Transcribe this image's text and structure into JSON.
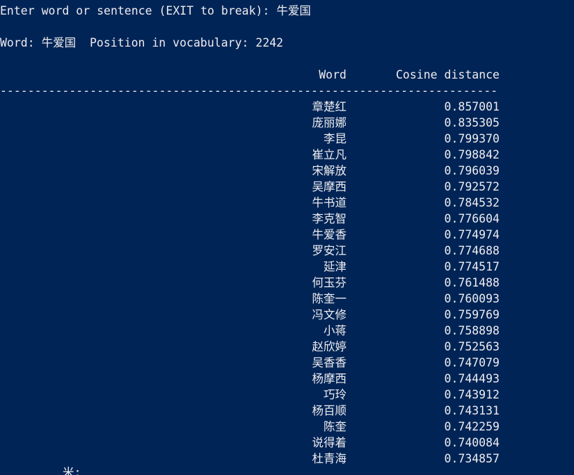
{
  "console": {
    "prompt_line": "Enter word or sentence (EXIT to break): 牛爱国",
    "word_line": "Word: 牛爱国  Position in vocabulary: 2242",
    "header": {
      "word": "Word",
      "distance": "Cosine distance"
    },
    "rule": "------------------------------------------------------------------------",
    "results": [
      {
        "word": "章楚红",
        "distance": "0.857001"
      },
      {
        "word": "庞丽娜",
        "distance": "0.835305"
      },
      {
        "word": "李昆",
        "distance": "0.799370"
      },
      {
        "word": "崔立凡",
        "distance": "0.798842"
      },
      {
        "word": "宋解放",
        "distance": "0.796039"
      },
      {
        "word": "吴摩西",
        "distance": "0.792572"
      },
      {
        "word": "牛书道",
        "distance": "0.784532"
      },
      {
        "word": "李克智",
        "distance": "0.776604"
      },
      {
        "word": "牛爱香",
        "distance": "0.774974"
      },
      {
        "word": "罗安江",
        "distance": "0.774688"
      },
      {
        "word": "延津",
        "distance": "0.774517"
      },
      {
        "word": "何玉芬",
        "distance": "0.761488"
      },
      {
        "word": "陈奎一",
        "distance": "0.760093"
      },
      {
        "word": "冯文修",
        "distance": "0.759769"
      },
      {
        "word": "小蒋",
        "distance": "0.758898"
      },
      {
        "word": "赵欣婷",
        "distance": "0.752563"
      },
      {
        "word": "吴香香",
        "distance": "0.747079"
      },
      {
        "word": "杨摩西",
        "distance": "0.744493"
      },
      {
        "word": "巧玲",
        "distance": "0.743912"
      },
      {
        "word": "杨百顺",
        "distance": "0.743131"
      },
      {
        "word": "陈奎",
        "distance": "0.742259"
      },
      {
        "word": "说得着",
        "distance": "0.740084"
      },
      {
        "word": "杜青海",
        "distance": "0.734857"
      }
    ],
    "trailing_text": "米:"
  }
}
